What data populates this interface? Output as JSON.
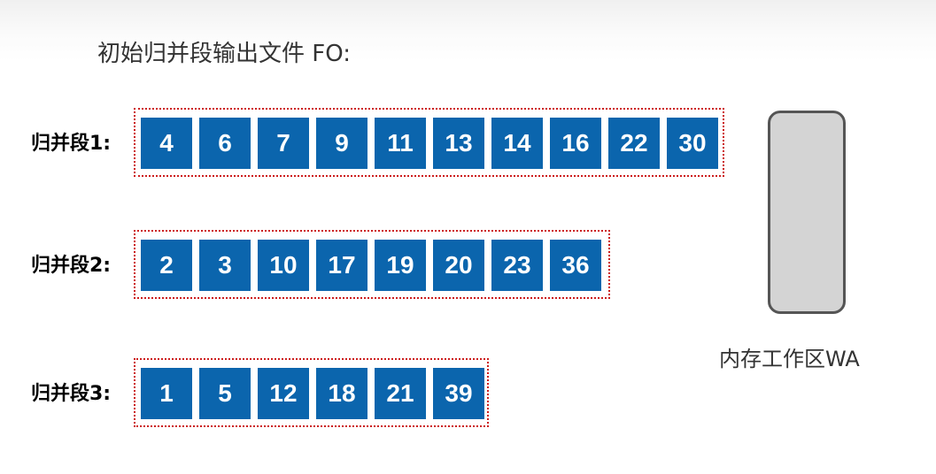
{
  "title": "初始归并段输出文件 FO:",
  "segments": [
    {
      "label": "归并段1:",
      "values": [
        "4",
        "6",
        "7",
        "9",
        "11",
        "13",
        "14",
        "16",
        "22",
        "30"
      ]
    },
    {
      "label": "归并段2:",
      "values": [
        "2",
        "3",
        "10",
        "17",
        "19",
        "20",
        "23",
        "36"
      ]
    },
    {
      "label": "归并段3:",
      "values": [
        "1",
        "5",
        "12",
        "18",
        "21",
        "39"
      ]
    }
  ],
  "work_area": {
    "label": "内存工作区WA"
  },
  "colors": {
    "cell": "#0b65ad",
    "segment_border": "#cc1f1f",
    "work_area_fill": "#d4d4d4"
  }
}
